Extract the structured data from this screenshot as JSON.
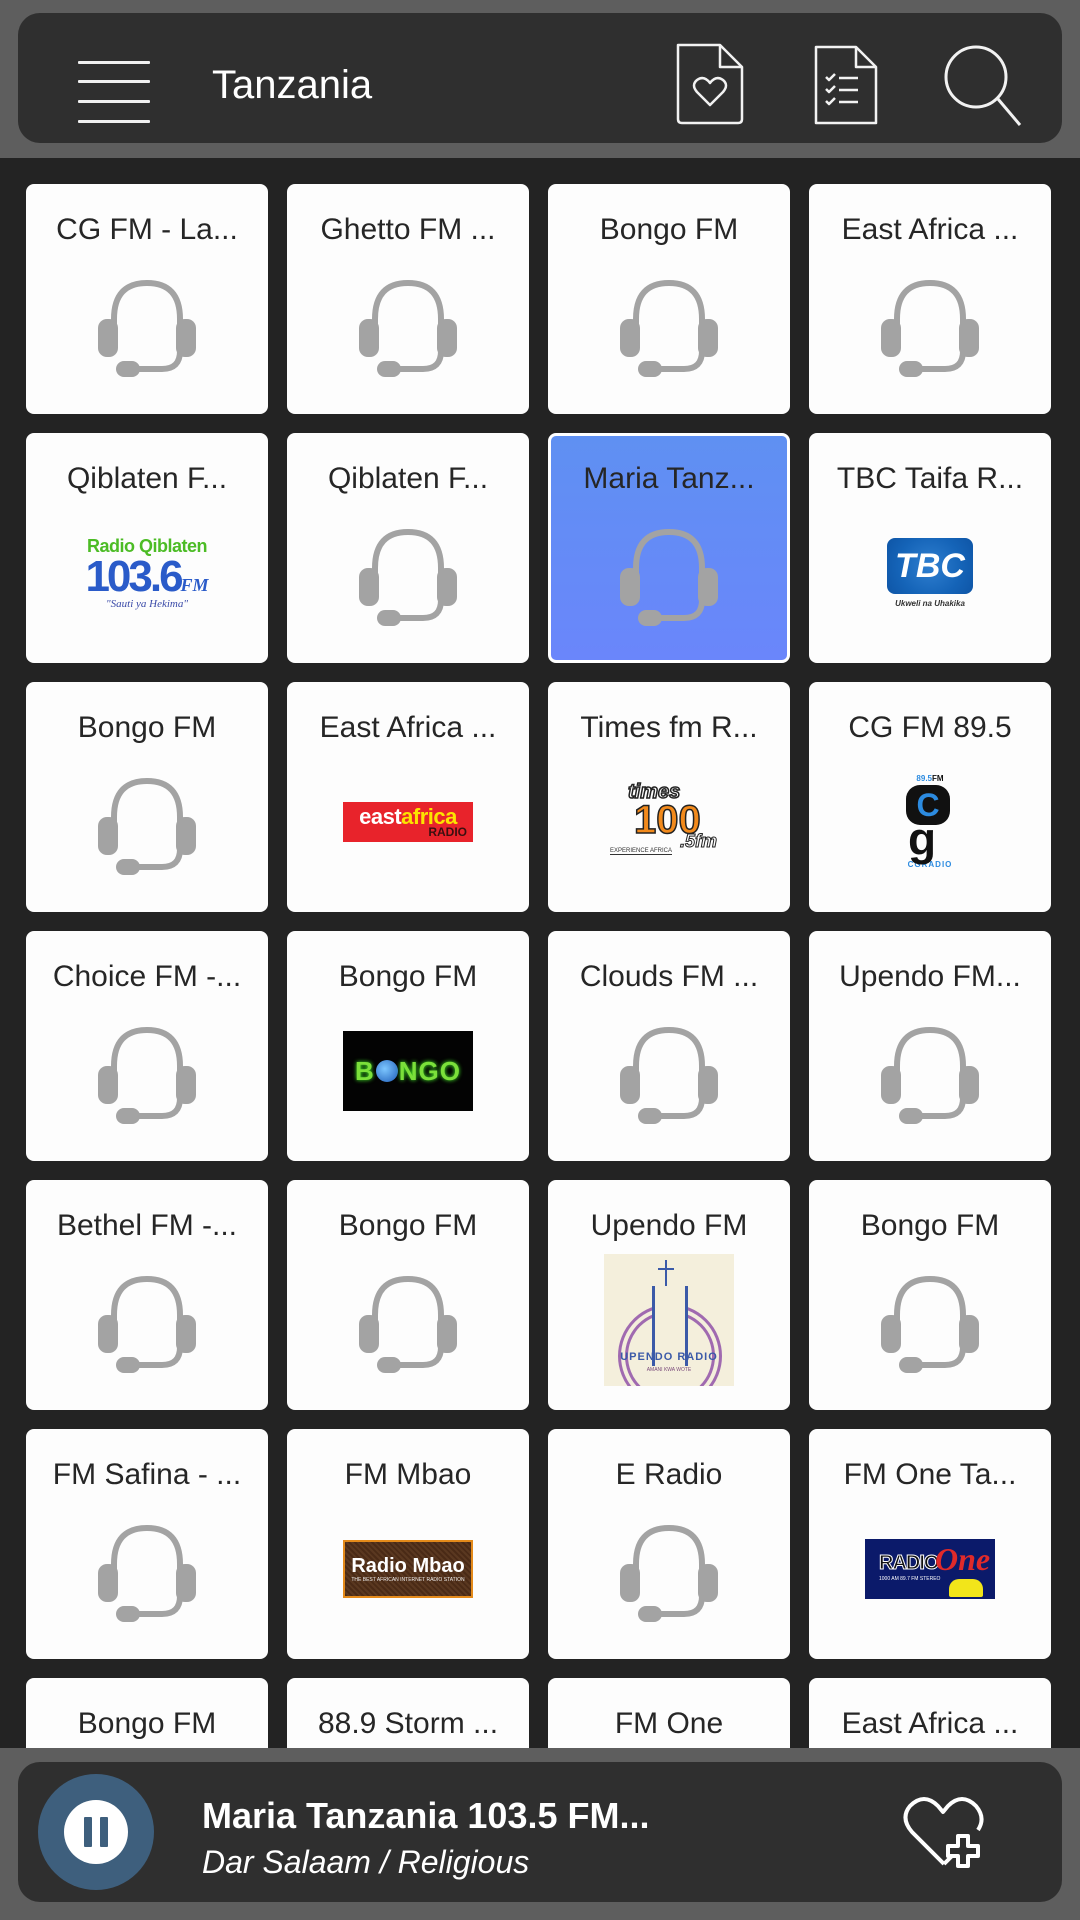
{
  "appbar": {
    "title": "Tanzania",
    "icons": [
      "menu-icon",
      "favorites-file-icon",
      "checklist-file-icon",
      "search-icon"
    ]
  },
  "stations": [
    {
      "title": "CG FM  - La...",
      "art": "headset",
      "selected": false
    },
    {
      "title": "Ghetto FM ...",
      "art": "headset",
      "selected": false
    },
    {
      "title": "Bongo FM",
      "art": "headset",
      "selected": false
    },
    {
      "title": "East Africa ...",
      "art": "headset",
      "selected": false
    },
    {
      "title": "Qiblaten F...",
      "art": "logo-qiblaten",
      "selected": false
    },
    {
      "title": "Qiblaten F...",
      "art": "headset",
      "selected": false
    },
    {
      "title": "Maria Tanz...",
      "art": "headset",
      "selected": true
    },
    {
      "title": "TBC Taifa R...",
      "art": "logo-tbc",
      "selected": false
    },
    {
      "title": "Bongo FM",
      "art": "headset",
      "selected": false
    },
    {
      "title": "East Africa ...",
      "art": "logo-eastafrica",
      "selected": false
    },
    {
      "title": "Times fm R...",
      "art": "logo-times",
      "selected": false
    },
    {
      "title": "CG FM  89.5",
      "art": "logo-cg",
      "selected": false
    },
    {
      "title": "Choice FM -...",
      "art": "headset",
      "selected": false
    },
    {
      "title": "Bongo FM",
      "art": "logo-bongo",
      "selected": false
    },
    {
      "title": "Clouds FM ...",
      "art": "headset",
      "selected": false
    },
    {
      "title": "Upendo FM...",
      "art": "headset",
      "selected": false
    },
    {
      "title": "Bethel FM -...",
      "art": "headset",
      "selected": false
    },
    {
      "title": "Bongo FM",
      "art": "headset",
      "selected": false
    },
    {
      "title": "Upendo FM",
      "art": "logo-upendo",
      "selected": false
    },
    {
      "title": "Bongo FM",
      "art": "headset",
      "selected": false
    },
    {
      "title": "FM Safina - ...",
      "art": "headset",
      "selected": false
    },
    {
      "title": "FM Mbao",
      "art": "logo-mbao",
      "selected": false
    },
    {
      "title": "E Radio",
      "art": "headset",
      "selected": false
    },
    {
      "title": "FM One Ta...",
      "art": "logo-one",
      "selected": false
    },
    {
      "title": "Bongo FM",
      "art": "headset",
      "selected": false
    },
    {
      "title": "88.9 Storm ...",
      "art": "headset",
      "selected": false
    },
    {
      "title": "FM One",
      "art": "headset",
      "selected": false
    },
    {
      "title": "East Africa ...",
      "art": "headset",
      "selected": false
    }
  ],
  "logos": {
    "qiblaten": {
      "line1": "Radio Qiblaten",
      "line2": "103.6",
      "fm": "FM",
      "tagline": "\"Sauti ya Hekima\""
    },
    "tbc": {
      "mark": "TBC",
      "tagline": "Ukweli na Uhakika"
    },
    "eastafrica": {
      "east": "east",
      "africa": "africa",
      "radio": "RADIO"
    },
    "times": {
      "word": "times",
      "num": "100",
      "fm": ".5fm",
      "tagline": "EXPERIENCE AFRICA"
    },
    "cg": {
      "freq": "89.5",
      "fm": "FM",
      "c": "C",
      "g": "g",
      "brand": "CGRADIO"
    },
    "bongo": {
      "b": "B",
      "rest": "NGO"
    },
    "upendo": {
      "text": "UPENDO   RADIO",
      "sub": "AMANI KWA WOTE"
    },
    "mbao": {
      "title": "Radio Mbao",
      "sub": "THE BEST AFRICAN INTERNET RADIO STATION"
    },
    "one": {
      "radio": "RADIO",
      "one": "One",
      "sub": "1000 AM  89.7 FM STEREO"
    }
  },
  "player": {
    "state": "playing",
    "title": "Maria Tanzania 103.5 FM...",
    "subtitle": "Dar Salaam / Religious"
  },
  "colors": {
    "selected_tile": "#6a86fb",
    "appbar_bg": "#2f2f2f",
    "grid_bg": "#232323",
    "pause_button": "#3e5f7d"
  }
}
